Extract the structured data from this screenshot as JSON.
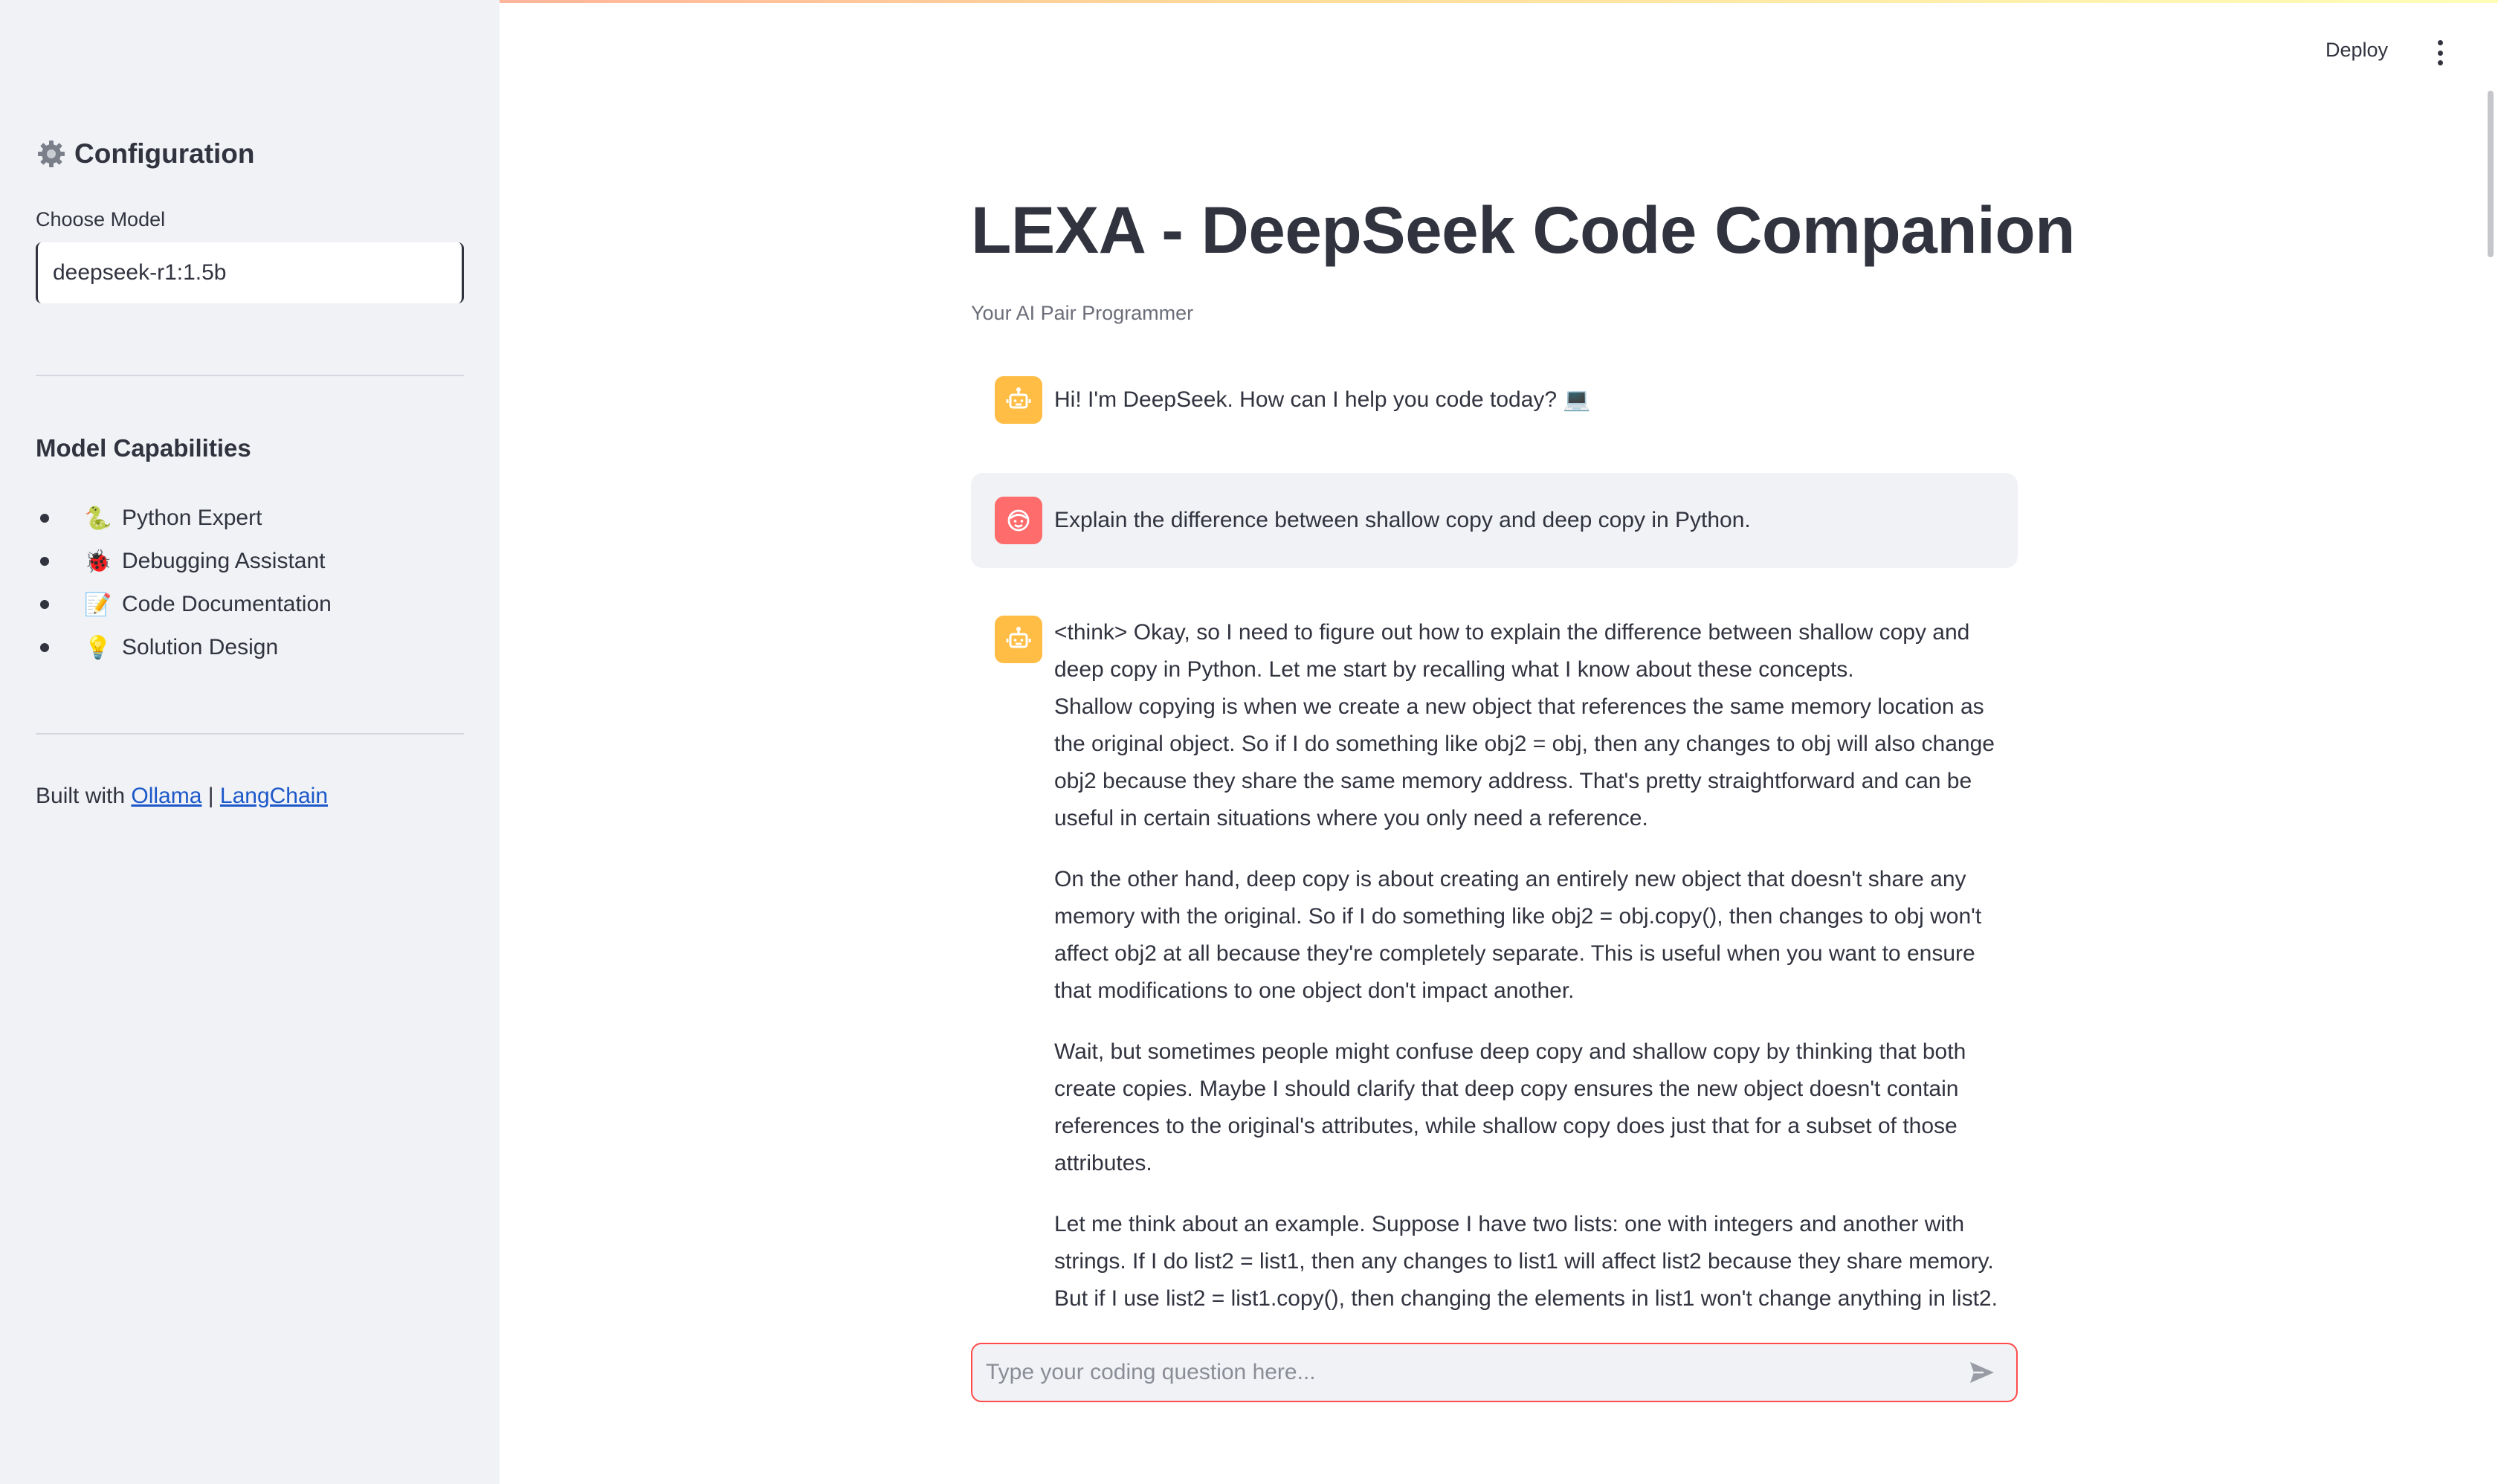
{
  "sidebar": {
    "heading": "Configuration",
    "model_label": "Choose Model",
    "model_value": "deepseek-r1:1.5b",
    "capabilities_heading": "Model Capabilities",
    "capabilities": [
      {
        "emoji": "🐍",
        "label": "Python Expert",
        "icon": "snake-icon"
      },
      {
        "emoji": "🐞",
        "label": "Debugging Assistant",
        "icon": "ladybug-icon"
      },
      {
        "emoji": "📝",
        "label": "Code Documentation",
        "icon": "memo-icon"
      },
      {
        "emoji": "💡",
        "label": "Solution Design",
        "icon": "lightbulb-icon"
      }
    ],
    "built_with_prefix": "Built with ",
    "built_with_sep": " | ",
    "link_ollama": "Ollama",
    "link_langchain": "LangChain"
  },
  "header": {
    "deploy_label": "Deploy"
  },
  "main": {
    "title": "LEXA - DeepSeek Code Companion",
    "subtitle": "Your AI Pair Programmer",
    "messages": [
      {
        "role": "assistant",
        "text": "Hi! I'm DeepSeek. How can I help you code today? 💻"
      },
      {
        "role": "user",
        "text": "Explain the difference between shallow copy and deep copy in Python."
      },
      {
        "role": "assistant",
        "paragraphs": [
          "<think> Okay, so I need to figure out how to explain the difference between shallow copy and deep copy in Python. Let me start by recalling what I know about these concepts.",
          "Shallow copying is when we create a new object that references the same memory location as the original object. So if I do something like obj2 = obj, then any changes to obj will also change obj2 because they share the same memory address. That's pretty straightforward and can be useful in certain situations where you only need a reference.",
          "On the other hand, deep copy is about creating an entirely new object that doesn't share any memory with the original. So if I do something like obj2 = obj.copy(), then changes to obj won't affect obj2 at all because they're completely separate. This is useful when you want to ensure that modifications to one object don't impact another.",
          "Wait, but sometimes people might confuse deep copy and shallow copy by thinking that both create copies. Maybe I should clarify that deep copy ensures the new object doesn't contain references to the original's attributes, while shallow copy does just that for a subset of those attributes.",
          "Let me think about an example. Suppose I have two lists: one with integers and another with strings. If I do list2 = list1, then any changes to list1 will affect list2 because they share memory. But if I use list2 = list1.copy(), then changing the elements in list1 won't change anything in list2."
        ]
      }
    ]
  },
  "chat_input": {
    "placeholder": "Type your coding question here...",
    "value": ""
  },
  "colors": {
    "sidebar_bg": "#f0f2f6",
    "assistant_avatar": "#ffbd45",
    "user_avatar": "#ff6c6c",
    "input_border": "#ff4b4b",
    "link": "#1c58c9"
  }
}
